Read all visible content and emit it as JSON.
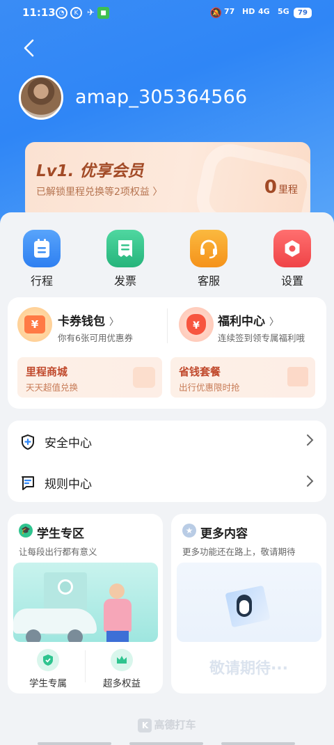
{
  "status": {
    "time": "11:13",
    "battery": "79",
    "sig1": "77",
    "sig2": "4G",
    "sig3": "5G",
    "hd": "HD"
  },
  "user": {
    "name": "amap_305364566"
  },
  "vip": {
    "level": "Lv1. 优享会员",
    "desc": "已解锁里程兑换等2项权益",
    "points": "0",
    "points_unit": "里程"
  },
  "quick": [
    {
      "label": "行程",
      "icon": "itinerary-icon",
      "color": "#3b8ef3"
    },
    {
      "label": "发票",
      "icon": "invoice-icon",
      "color": "#35c48b"
    },
    {
      "label": "客服",
      "icon": "customer-service-icon",
      "color": "#f7a12b"
    },
    {
      "label": "设置",
      "icon": "settings-icon",
      "color": "#f4565a"
    }
  ],
  "wallet": {
    "title": "卡券钱包",
    "sub": "你有6张可用优惠券"
  },
  "welfare": {
    "title": "福利中心",
    "sub": "连续签到领专属福利哦"
  },
  "promos": [
    {
      "title": "里程商城",
      "sub": "天天超值兑换"
    },
    {
      "title": "省钱套餐",
      "sub": "出行优惠限时抢"
    }
  ],
  "menu": [
    {
      "label": "安全中心",
      "icon": "shield-icon"
    },
    {
      "label": "规则中心",
      "icon": "rules-icon"
    }
  ],
  "student": {
    "title": "学生专区",
    "sub": "让每段出行都有意义",
    "items": [
      "学生专属",
      "超多权益"
    ]
  },
  "more": {
    "title": "更多内容",
    "sub": "更多功能还在路上，敬请期待",
    "placeholder": "敬请期待···"
  },
  "footer": {
    "brand": "高德打车"
  }
}
